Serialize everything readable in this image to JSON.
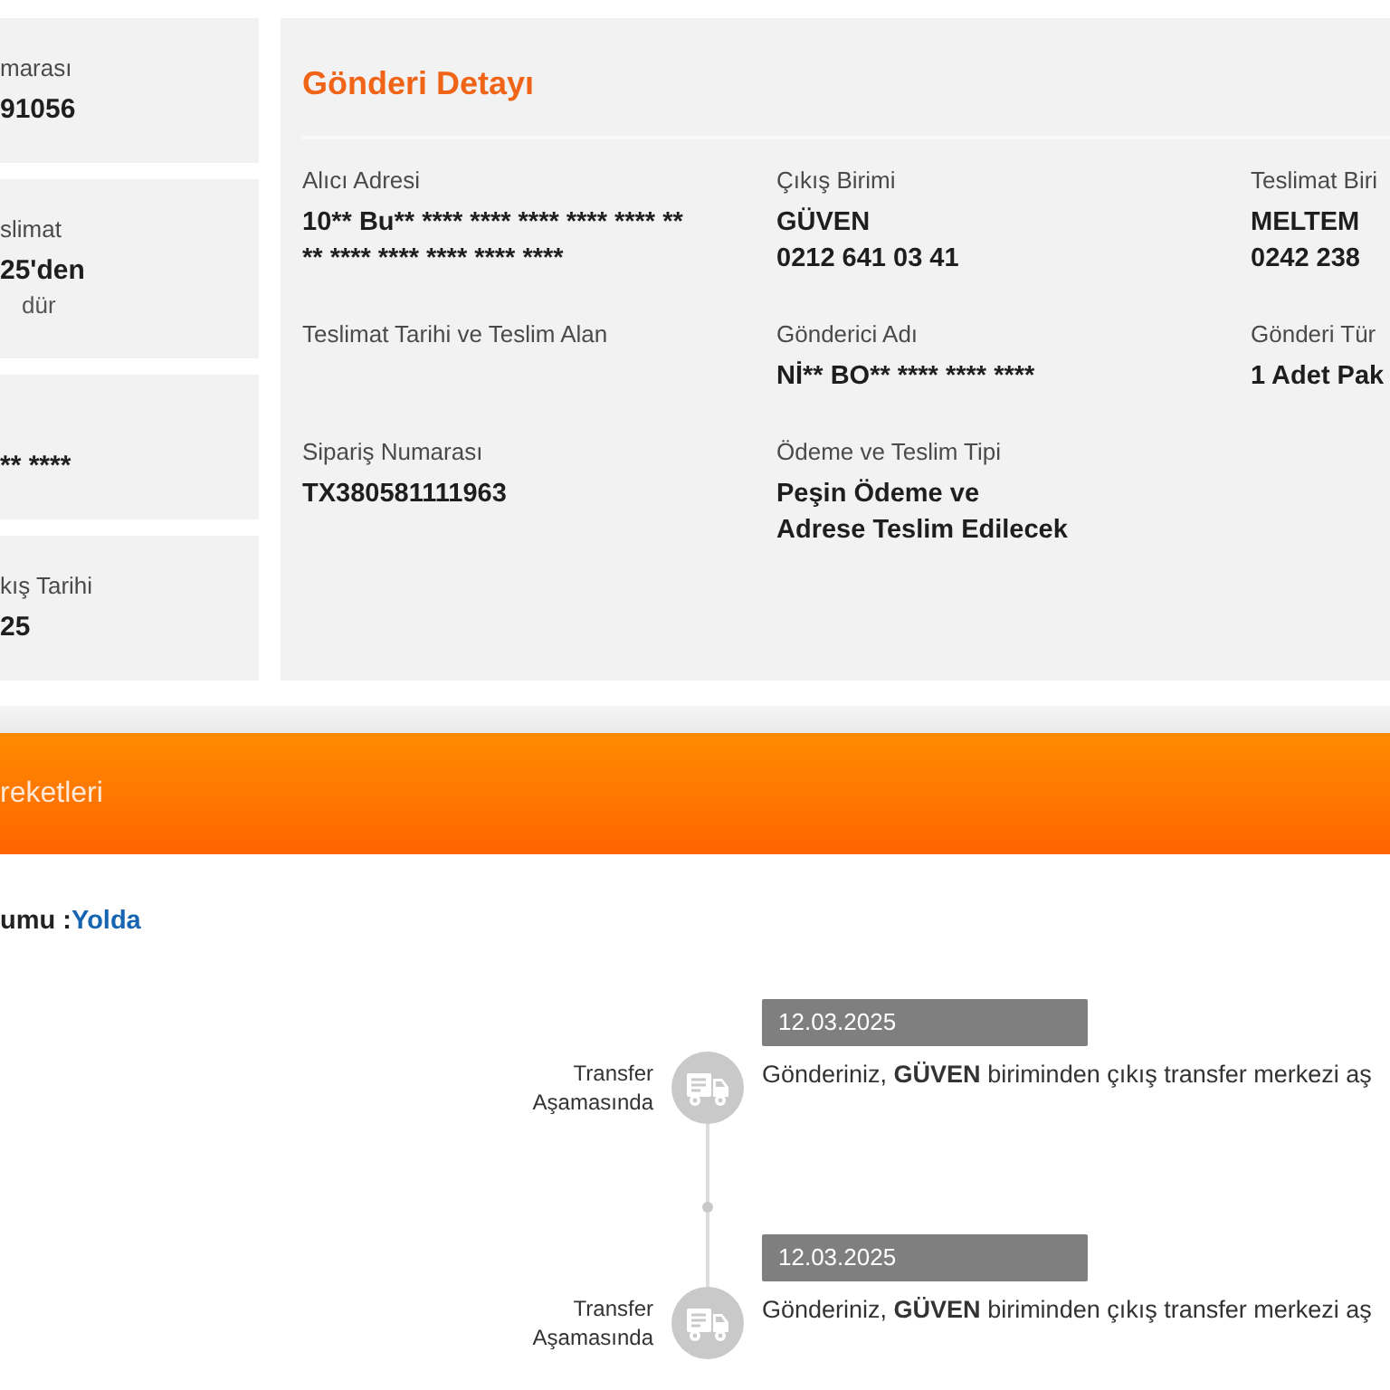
{
  "summary_cards": [
    {
      "label": "marası",
      "value": "91056"
    },
    {
      "label": "slimat",
      "value": "25'den",
      "note": "dür"
    },
    {
      "value": "** ****"
    },
    {
      "label": "kış Tarihi",
      "value": "25"
    }
  ],
  "shipment_detail": {
    "title": "Gönderi Detayı",
    "fields": [
      {
        "label": "Alıcı Adresi",
        "lines": [
          "10** Bu** **** **** **** **** **** **",
          "** **** **** **** **** ****"
        ]
      },
      {
        "label": "Çıkış Birimi",
        "lines": [
          "GÜVEN",
          "0212 641 03 41"
        ]
      },
      {
        "label": "Teslimat Biri",
        "lines": [
          "MELTEM",
          "0242 238"
        ]
      },
      {
        "label": "Teslimat Tarihi ve Teslim Alan"
      },
      {
        "label": "Gönderici Adı",
        "lines": [
          "Nİ** BO** **** **** ****"
        ]
      },
      {
        "label": "Gönderi Tür",
        "lines": [
          "1 Adet Pak"
        ]
      },
      {
        "label": "Sipariş Numarası",
        "lines": [
          "TX380581111963"
        ]
      },
      {
        "label": "Ödeme ve Teslim Tipi",
        "lines": [
          "Peşin Ödeme ve",
          "Adrese Teslim Edilecek"
        ]
      }
    ]
  },
  "movements_header": {
    "title": "reketleri"
  },
  "status": {
    "label": "umu :",
    "value": "Yolda"
  },
  "timeline": [
    {
      "date": "12.03.2025",
      "stage": "Transfer Aşamasında",
      "description": "Gönderiniz, **GÜVEN** biriminden çıkış transfer merkezi aş"
    },
    {
      "date": "12.03.2025",
      "stage": "Transfer Aşamasında",
      "description": "Gönderiniz, **GÜVEN** biriminden çıkış transfer merkezi aş"
    }
  ]
}
